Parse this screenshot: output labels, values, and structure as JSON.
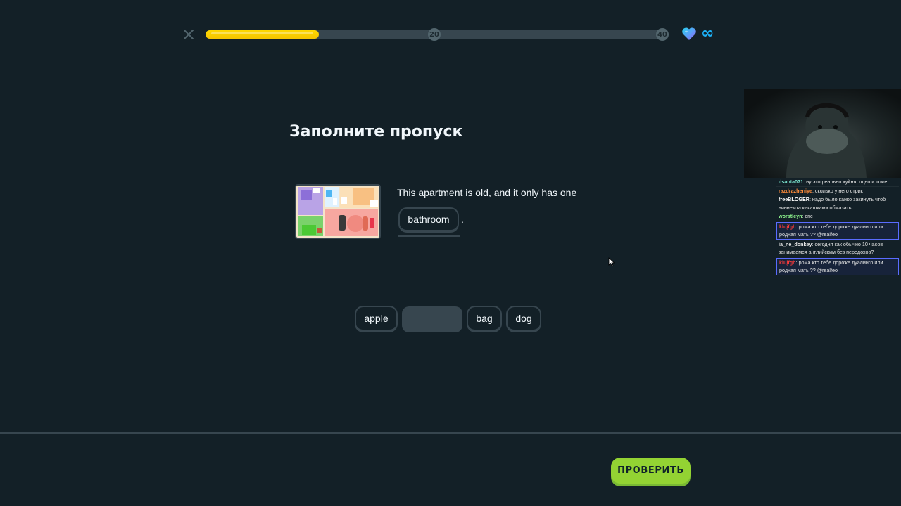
{
  "lesson": {
    "progress": {
      "fraction": 0.245,
      "milestones": [
        "20",
        "40"
      ]
    },
    "hearts": {
      "value": "∞"
    }
  },
  "exercise": {
    "title": "Заполните пропуск",
    "sentence": "This apartment is old, and it only has one",
    "selected_answer": "bathroom",
    "sentence_end": ".",
    "word_bank": [
      "apple",
      "bag",
      "dog"
    ]
  },
  "footer": {
    "check_label": "ПРОВЕРИТЬ"
  },
  "colors": {
    "progress": "#f5c400",
    "check_button": "#93d333",
    "background": "#132027",
    "heart_gradient": [
      "#28d0f0",
      "#9b5cf5"
    ]
  },
  "stream_chat": [
    {
      "user": "dsanta071",
      "user_color": "#7be6d0",
      "text": "ну это реально хуйня, одно и тоже"
    },
    {
      "user": "razdrazheniye",
      "user_color": "#ff8c3a",
      "text": "сколько у него стрик"
    },
    {
      "user": "freeBLOGER",
      "user_color": "#ffffff",
      "text": "надо было канко закинуть чтоб виннемта какашками обмазать"
    },
    {
      "user": "worstleyn",
      "user_color": "#8ef58e",
      "text": "спс"
    },
    {
      "user": "kluįfgh",
      "user_color": "#ff3b3b",
      "text": "рома кто тебе дороже дуалинго или родная мать ?? @realfeo",
      "highlight": true
    },
    {
      "user": "ia_ne_donkey",
      "user_color": "#e6e6e6",
      "text": "сегодня как обычно 10 часов занимаемся английским без передохов?"
    },
    {
      "user": "kluįfgh",
      "user_color": "#ff3b3b",
      "text": "рома кто тебе дороже дуалинго или родная мать ?? @realfeo",
      "highlight": true
    }
  ]
}
